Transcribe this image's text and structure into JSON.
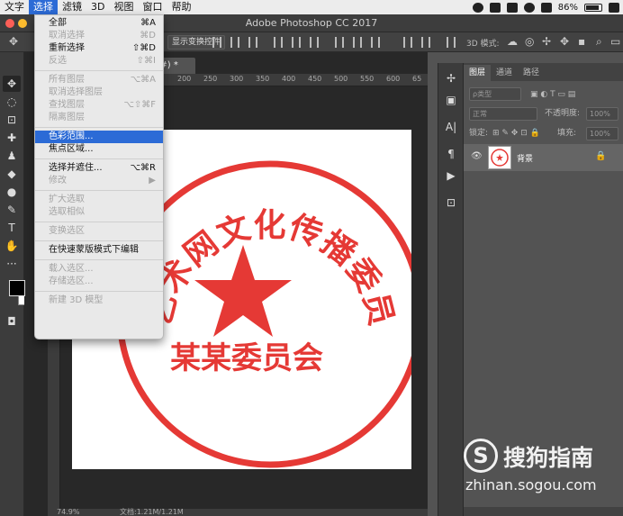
{
  "menubar": {
    "items": [
      "文字",
      "选择",
      "滤镜",
      "3D",
      "视图",
      "窗口",
      "帮助"
    ],
    "active_index": 1,
    "battery": "86%"
  },
  "window": {
    "title": "Adobe Photoshop CC 2017"
  },
  "options_bar": {
    "show_transform": "显示变换控件",
    "mode_3d": "3D 模式:"
  },
  "document": {
    "tab_suffix": "8#) *",
    "ruler_ticks": [
      "200",
      "250",
      "300",
      "350",
      "400",
      "450",
      "500",
      "550",
      "600",
      "65"
    ],
    "zoom": "74.9%",
    "doc_info": "文档:1.21M/1.21M"
  },
  "stamp": {
    "arc_text": "卜艺术网文化传播委员会",
    "bottom_text": "某某委员会",
    "color": "#e53935"
  },
  "select_menu": {
    "items": [
      {
        "label": "全部",
        "shortcut": "⌘A",
        "enabled": true
      },
      {
        "label": "取消选择",
        "shortcut": "⌘D",
        "enabled": false
      },
      {
        "label": "重新选择",
        "shortcut": "⇧⌘D",
        "enabled": true
      },
      {
        "label": "反选",
        "shortcut": "⇧⌘I",
        "enabled": false
      },
      {
        "sep": true
      },
      {
        "label": "所有图层",
        "shortcut": "⌥⌘A",
        "enabled": false
      },
      {
        "label": "取消选择图层",
        "shortcut": "",
        "enabled": false
      },
      {
        "label": "查找图层",
        "shortcut": "⌥⇧⌘F",
        "enabled": false
      },
      {
        "label": "隔离图层",
        "shortcut": "",
        "enabled": false
      },
      {
        "sep": true
      },
      {
        "label": "色彩范围...",
        "shortcut": "",
        "enabled": true,
        "highlighted": true
      },
      {
        "label": "焦点区域...",
        "shortcut": "",
        "enabled": true
      },
      {
        "sep": true
      },
      {
        "label": "选择并遮住...",
        "shortcut": "⌥⌘R",
        "enabled": true
      },
      {
        "label": "修改",
        "shortcut": "▶",
        "enabled": false
      },
      {
        "sep": true
      },
      {
        "label": "扩大选取",
        "shortcut": "",
        "enabled": false
      },
      {
        "label": "选取相似",
        "shortcut": "",
        "enabled": false
      },
      {
        "sep": true
      },
      {
        "label": "变换选区",
        "shortcut": "",
        "enabled": false
      },
      {
        "sep": true
      },
      {
        "label": "在快速蒙版模式下编辑",
        "shortcut": "",
        "enabled": true
      },
      {
        "sep": true
      },
      {
        "label": "载入选区...",
        "shortcut": "",
        "enabled": false
      },
      {
        "label": "存储选区...",
        "shortcut": "",
        "enabled": false
      },
      {
        "sep": true
      },
      {
        "label": "新建 3D 模型",
        "shortcut": "",
        "enabled": false
      }
    ]
  },
  "layers_panel": {
    "tabs": [
      "图层",
      "通道",
      "路径"
    ],
    "filter_label": "ρ类型",
    "blend_mode": "正常",
    "opacity_label": "不透明度:",
    "opacity_value": "100%",
    "lock_label": "锁定:",
    "fill_label": "填充:",
    "fill_value": "100%",
    "layer_name": "背景"
  },
  "watermark": {
    "logo_char": "S",
    "brand": "搜狗指南",
    "url": "zhinan.sogou.com"
  }
}
